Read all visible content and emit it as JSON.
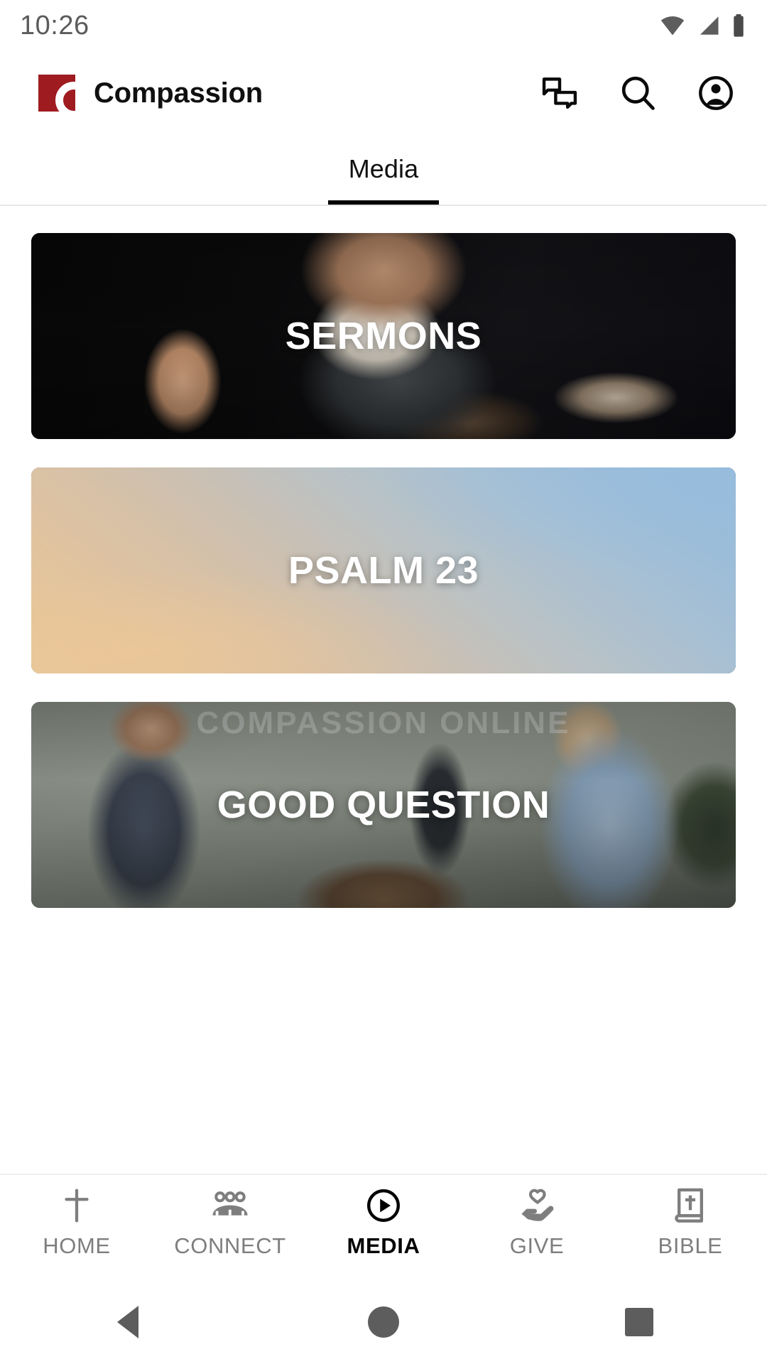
{
  "status_bar": {
    "time": "10:26",
    "icons": [
      "wifi-icon",
      "cellular-signal-icon",
      "battery-icon"
    ]
  },
  "app_bar": {
    "brand_name": "Compassion",
    "logo_icon": "compassion-logo",
    "logo_color": "#9e1b20",
    "actions": [
      {
        "name": "messages-icon",
        "label": "Messages"
      },
      {
        "name": "search-icon",
        "label": "Search"
      },
      {
        "name": "account-icon",
        "label": "Account"
      }
    ]
  },
  "tabs": {
    "active_index": 0,
    "items": [
      {
        "label": "Media"
      }
    ]
  },
  "media_cards": [
    {
      "title": "SERMONS",
      "style": "bg-sermons",
      "watermark": ""
    },
    {
      "title": "PSALM 23",
      "style": "bg-psalm",
      "watermark": ""
    },
    {
      "title": "GOOD QUESTION",
      "style": "bg-goodq",
      "watermark": "COMPASSION\nONLINE"
    }
  ],
  "bottom_nav": {
    "active": "MEDIA",
    "items": [
      {
        "label": "HOME",
        "icon": "cross-icon"
      },
      {
        "label": "CONNECT",
        "icon": "people-group-icon"
      },
      {
        "label": "MEDIA",
        "icon": "play-circle-icon"
      },
      {
        "label": "GIVE",
        "icon": "hand-heart-icon"
      },
      {
        "label": "BIBLE",
        "icon": "bible-book-icon"
      }
    ]
  },
  "system_nav": {
    "items": [
      {
        "name": "android-back-button"
      },
      {
        "name": "android-home-button"
      },
      {
        "name": "android-recents-button"
      }
    ]
  }
}
